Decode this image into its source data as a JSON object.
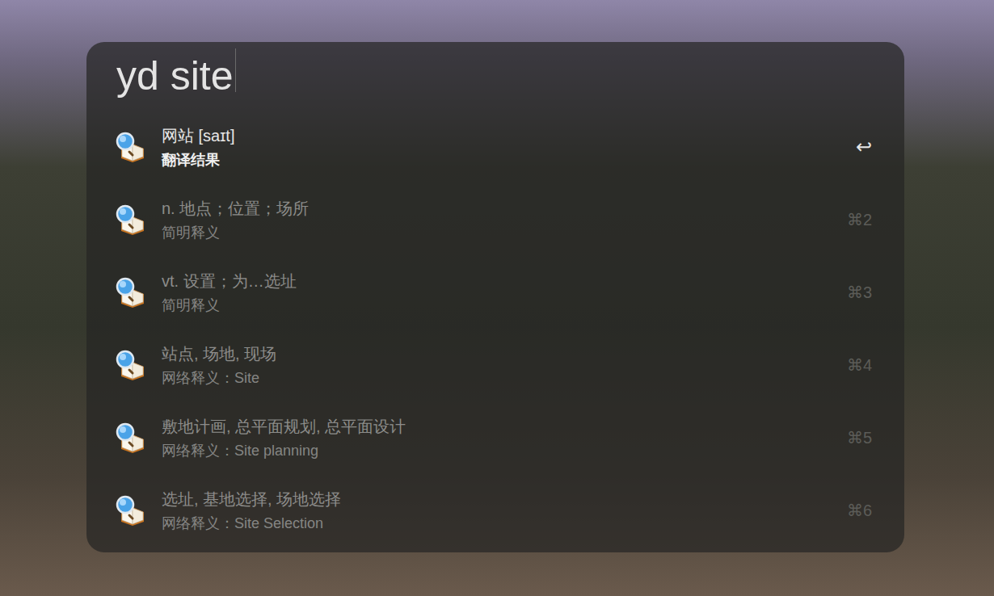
{
  "launcher": {
    "query": "yd site",
    "results": [
      {
        "title": "网站 [saɪt]",
        "subtitle": "翻译结果",
        "shortcut": "↩",
        "selected": true
      },
      {
        "title": "n. 地点；位置；场所",
        "subtitle": "简明释义",
        "shortcut": "⌘2",
        "selected": false
      },
      {
        "title": "vt. 设置；为…选址",
        "subtitle": "简明释义",
        "shortcut": "⌘3",
        "selected": false
      },
      {
        "title": "站点, 场地, 现场",
        "subtitle": "网络释义：Site",
        "shortcut": "⌘4",
        "selected": false
      },
      {
        "title": "敷地计画, 总平面规划, 总平面设计",
        "subtitle": "网络释义：Site planning",
        "shortcut": "⌘5",
        "selected": false
      },
      {
        "title": "选址, 基地选择, 场地选择",
        "subtitle": "网络释义：Site Selection",
        "shortcut": "⌘6",
        "selected": false
      }
    ]
  }
}
